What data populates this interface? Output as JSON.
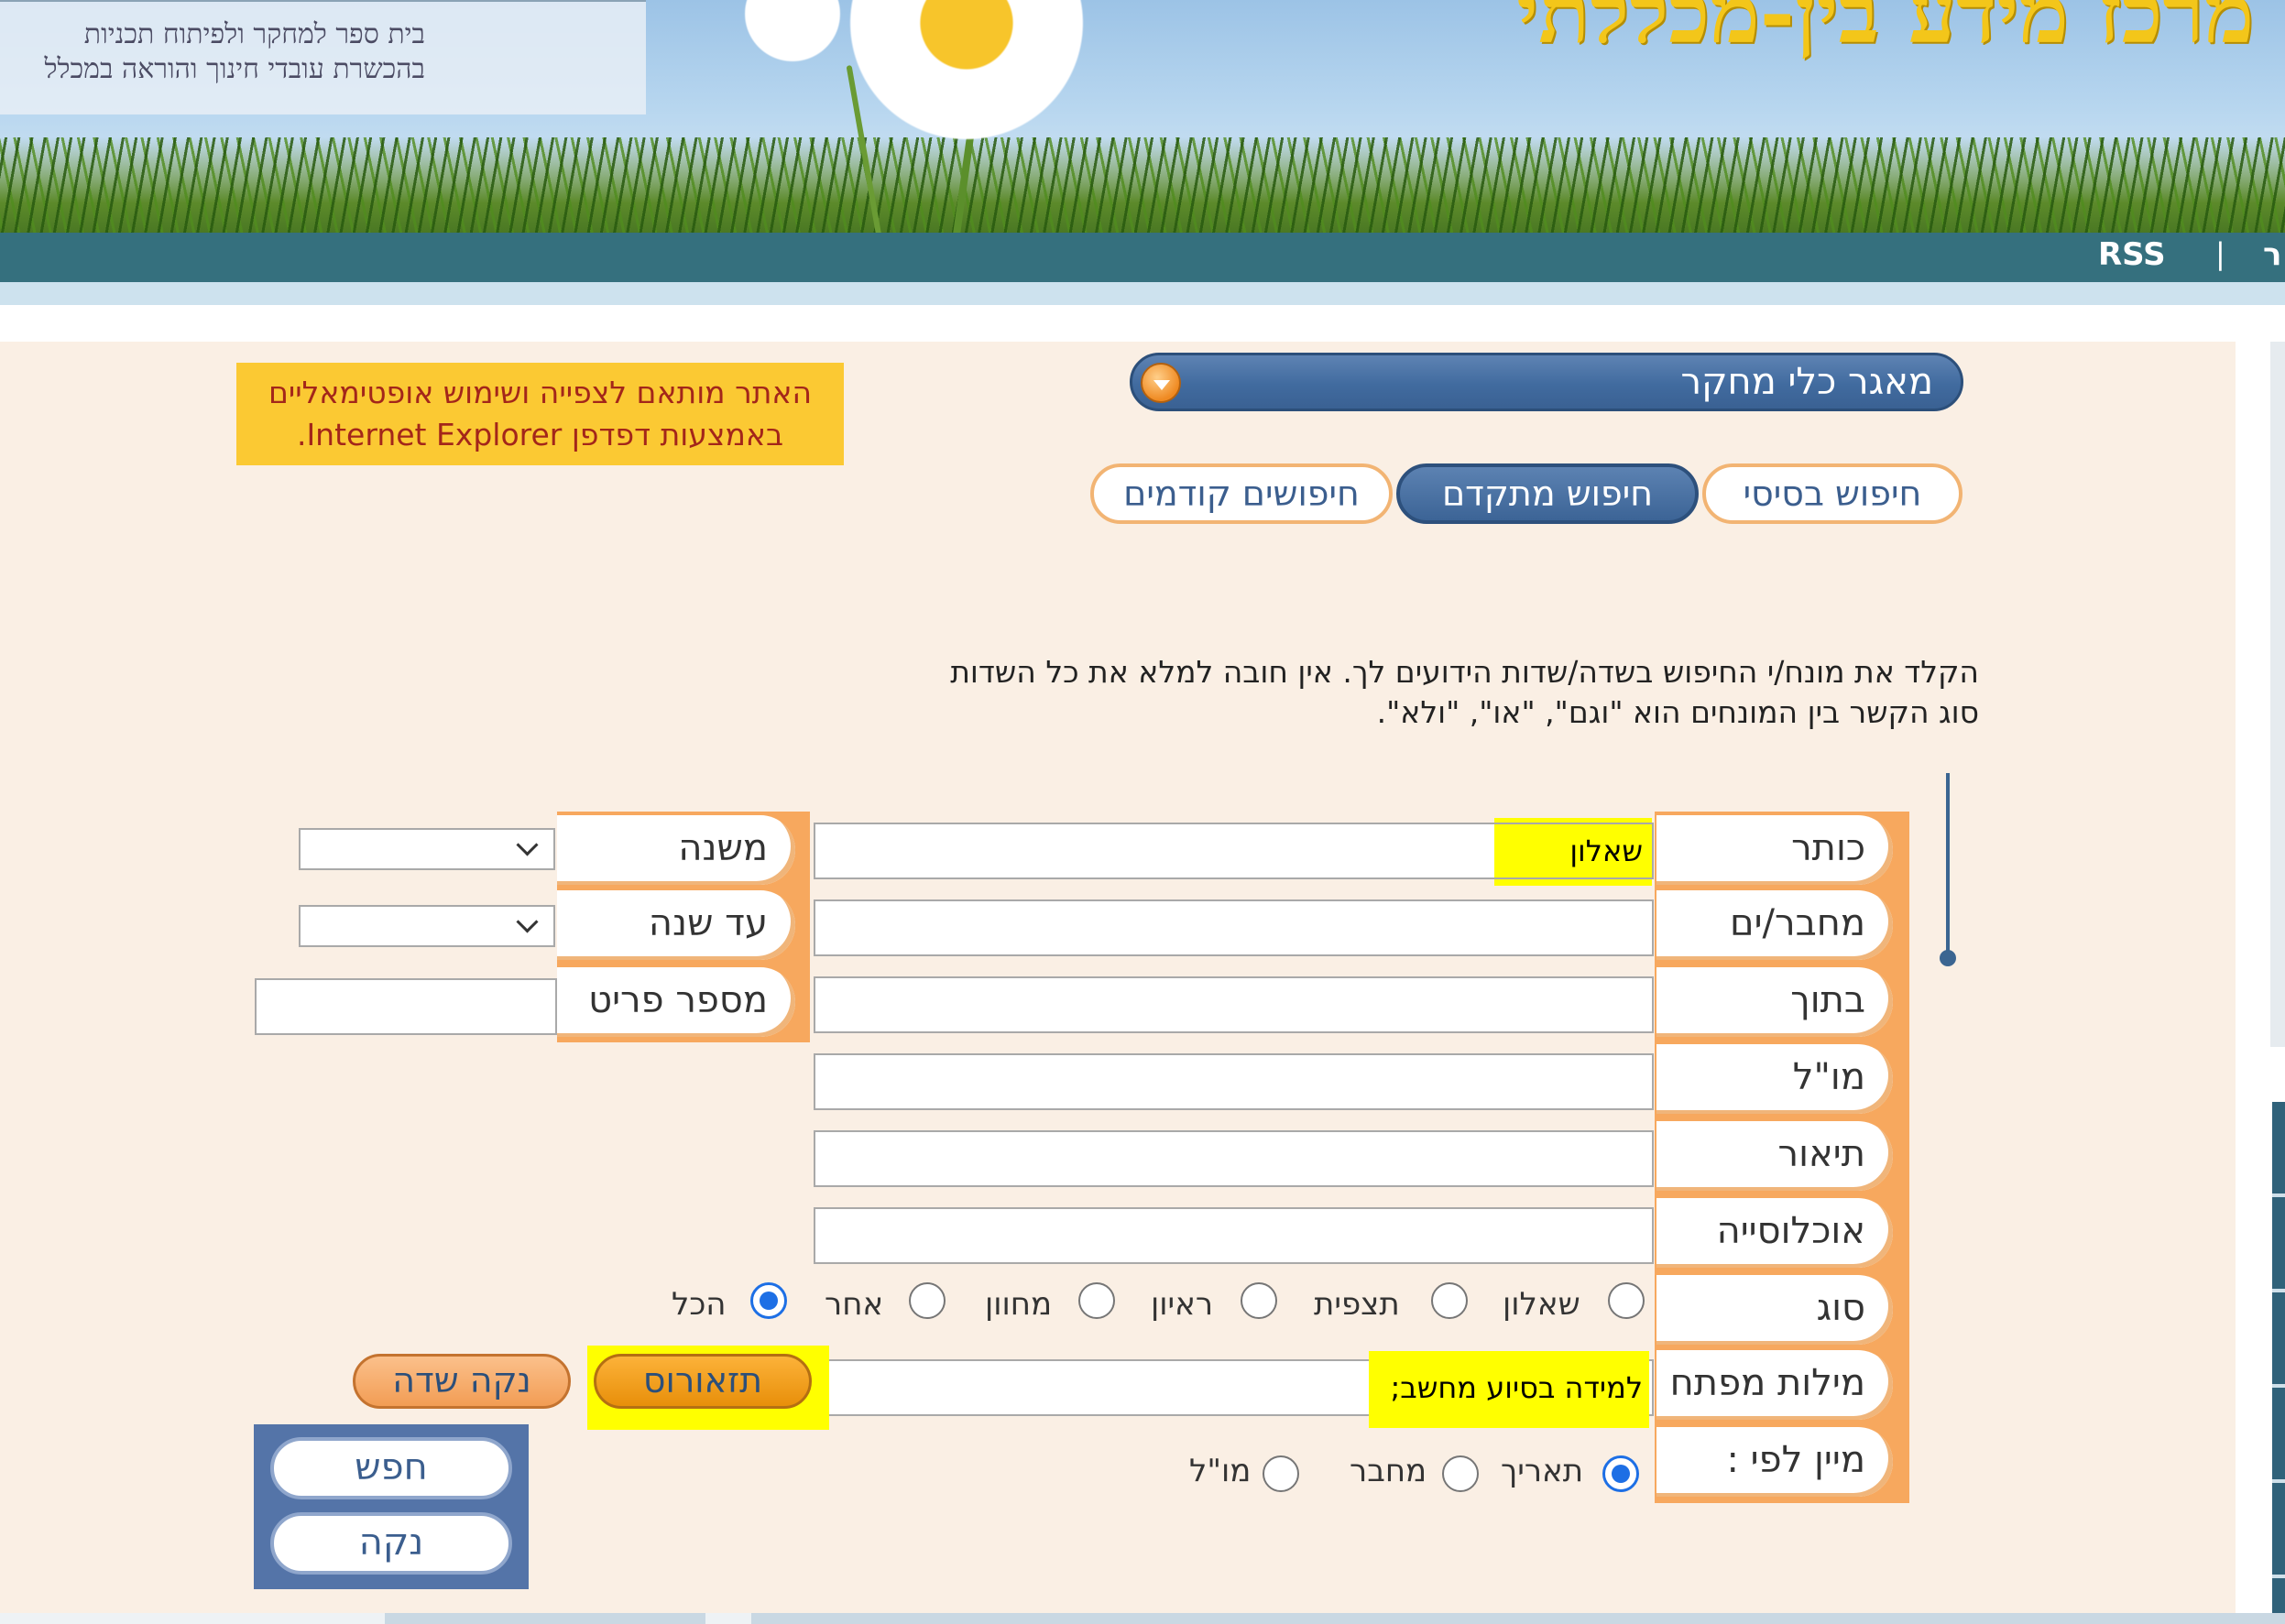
{
  "header": {
    "logo_line1": "בית ספר למחקר ולפיתוח תכניות",
    "logo_line2": "בהכשרת עובדי חינוך והוראה במכלל",
    "site_title": "מרכז מידע בין-מכללתי",
    "nav": {
      "rss": "RSS",
      "separator": "|",
      "cut_item": "ר"
    }
  },
  "notice": {
    "line1": "האתר מותאם לצפייה ושימוש אופטימאליים",
    "line2": "באמצעות דפדפן Internet Explorer."
  },
  "database_select": {
    "selected": "מאגר כלי מחקר"
  },
  "tabs": [
    {
      "label": "חיפוש בסיסי",
      "active": false
    },
    {
      "label": "חיפוש מתקדם",
      "active": true
    },
    {
      "label": "חיפושים קודמים",
      "active": false
    }
  ],
  "instructions": {
    "line1": "הקלד את מונח/י החיפוש בשדה/שדות הידועים לך. אין חובה למלא את כל השדות",
    "line2": "סוג הקשר בין המונחים הוא \"וגם\", \"או\", \"ולא\"."
  },
  "form": {
    "title_label": "כותר",
    "title_value": "שאלון",
    "authors_label": "מחבר/ים",
    "in_label": "בתוך",
    "publisher_label": "מו\"ל",
    "description_label": "תיאור",
    "population_label": "אוכלוסייה",
    "type_label": "סוג",
    "keywords_label": "מילות מפתח",
    "keywords_value": "למידה בסיוע מחשב;",
    "sort_label": "מיין לפי :",
    "year_from_label": "משנה",
    "year_to_label": "עד שנה",
    "catalog_label": "מספר פריט",
    "type_options": [
      "שאלון",
      "תצפית",
      "ראיון",
      "מחוון",
      "אחר",
      "הכל"
    ],
    "type_selected": "הכל",
    "sort_options": [
      "תאריך",
      "מחבר",
      "מו\"ל"
    ],
    "sort_selected": "תאריך",
    "thesaurus_button": "תזאורוס",
    "clear_field_button": "נקה שדה",
    "search_button": "חפש",
    "reset_button": "נקה"
  },
  "colors": {
    "panel_bg": "#faefe4",
    "accent_orange": "#f7a85e",
    "accent_blue": "#3c6496",
    "highlight": "#ffff00",
    "notice_bg": "#fbc933"
  }
}
